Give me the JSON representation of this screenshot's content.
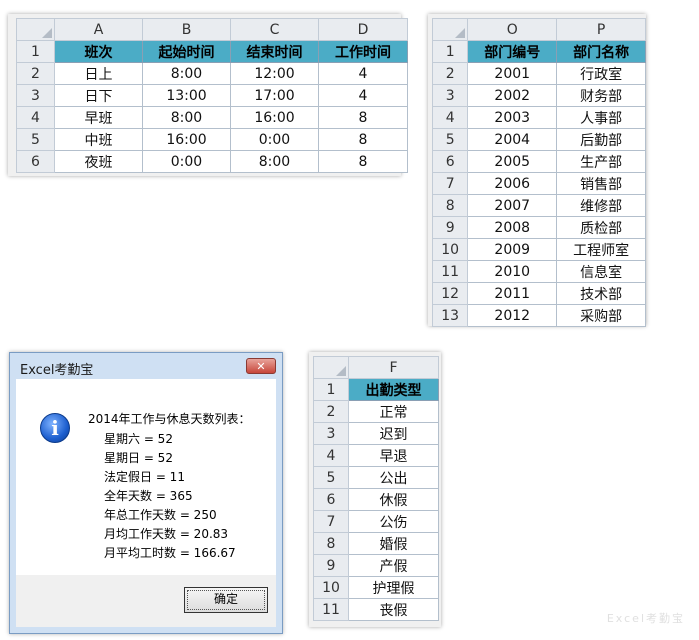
{
  "shifts": {
    "columns": [
      "A",
      "B",
      "C",
      "D"
    ],
    "rows": [
      "1",
      "2",
      "3",
      "4",
      "5",
      "6"
    ],
    "header": [
      "班次",
      "起始时间",
      "结束时间",
      "工作时间"
    ],
    "data": [
      [
        "日上",
        "8:00",
        "12:00",
        "4"
      ],
      [
        "日下",
        "13:00",
        "17:00",
        "4"
      ],
      [
        "早班",
        "8:00",
        "16:00",
        "8"
      ],
      [
        "中班",
        "16:00",
        "0:00",
        "8"
      ],
      [
        "夜班",
        "0:00",
        "8:00",
        "8"
      ]
    ]
  },
  "departments": {
    "columns": [
      "O",
      "P"
    ],
    "rows": [
      "1",
      "2",
      "3",
      "4",
      "5",
      "6",
      "7",
      "8",
      "9",
      "10",
      "11",
      "12",
      "13"
    ],
    "header": [
      "部门编号",
      "部门名称"
    ],
    "data": [
      [
        "2001",
        "行政室"
      ],
      [
        "2002",
        "财务部"
      ],
      [
        "2003",
        "人事部"
      ],
      [
        "2004",
        "后勤部"
      ],
      [
        "2005",
        "生产部"
      ],
      [
        "2006",
        "销售部"
      ],
      [
        "2007",
        "维修部"
      ],
      [
        "2008",
        "质检部"
      ],
      [
        "2009",
        "工程师室"
      ],
      [
        "2010",
        "信息室"
      ],
      [
        "2011",
        "技术部"
      ],
      [
        "2012",
        "采购部"
      ]
    ]
  },
  "attendance": {
    "columns": [
      "F"
    ],
    "rows": [
      "1",
      "2",
      "3",
      "4",
      "5",
      "6",
      "7",
      "8",
      "9",
      "10",
      "11"
    ],
    "header": [
      "出勤类型"
    ],
    "data": [
      "正常",
      "迟到",
      "早退",
      "公出",
      "休假",
      "公伤",
      "婚假",
      "产假",
      "护理假",
      "丧假"
    ]
  },
  "dialog": {
    "title": "Excel考勤宝",
    "close_label": "✕",
    "icon": "info-icon",
    "heading": "2014年工作与休息天数列表：",
    "lines": [
      "星期六 = 52",
      "星期日 = 52",
      "法定假日 = 11",
      "全年天数 = 365",
      "年总工作天数 = 250",
      "月均工作天数 = 20.83",
      "月平均工时数 = 166.67"
    ],
    "ok_label": "确定"
  },
  "watermark": "Excel考勤宝"
}
